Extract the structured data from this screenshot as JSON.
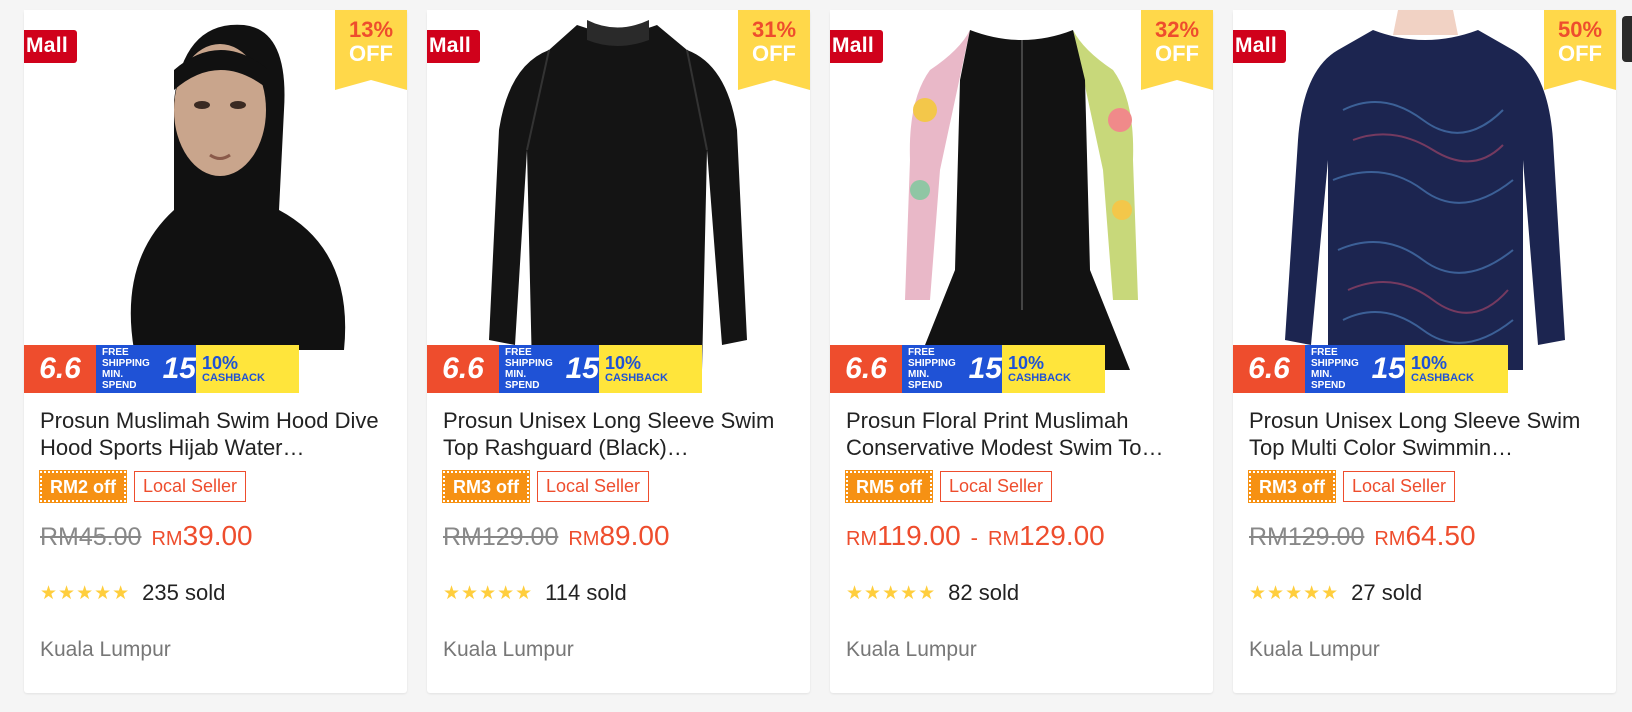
{
  "products": [
    {
      "mall": "Mall",
      "discount": "13%",
      "off_label": "OFF",
      "promo": {
        "sale": "6.6",
        "ship_text": "FREE SHIPPING MIN. SPEND",
        "ship_amount": "15",
        "cashback_pct": "10%",
        "cashback_label": "CASHBACK"
      },
      "name": "Prosun Muslimah Swim Hood Dive Hood Sports Hijab Water…",
      "voucher": "RM2 off",
      "seller": "Local Seller",
      "price_old": "RM45.00",
      "currency": "RM",
      "price": "39.00",
      "price_max": "",
      "stars": "★★★★★",
      "sold": "235 sold",
      "location": "Kuala Lumpur",
      "image": "black-hijab-swim-hood"
    },
    {
      "mall": "Mall",
      "discount": "31%",
      "off_label": "OFF",
      "promo": {
        "sale": "6.6",
        "ship_text": "FREE SHIPPING MIN. SPEND",
        "ship_amount": "15",
        "cashback_pct": "10%",
        "cashback_label": "CASHBACK"
      },
      "name": "Prosun Unisex Long Sleeve Swim Top Rashguard (Black)…",
      "voucher": "RM3 off",
      "seller": "Local Seller",
      "price_old": "RM129.00",
      "currency": "RM",
      "price": "89.00",
      "price_max": "",
      "stars": "★★★★★",
      "sold": "114 sold",
      "location": "Kuala Lumpur",
      "image": "black-rashguard"
    },
    {
      "mall": "Mall",
      "discount": "32%",
      "off_label": "OFF",
      "promo": {
        "sale": "6.6",
        "ship_text": "FREE SHIPPING MIN. SPEND",
        "ship_amount": "15",
        "cashback_pct": "10%",
        "cashback_label": "CASHBACK"
      },
      "name": "Prosun Floral Print Muslimah Conservative Modest Swim To…",
      "voucher": "RM5 off",
      "seller": "Local Seller",
      "price_old": "",
      "currency": "RM",
      "price": "119.00",
      "price_max": "129.00",
      "stars": "★★★★★",
      "sold": "82 sold",
      "location": "Kuala Lumpur",
      "image": "floral-swim-dress"
    },
    {
      "mall": "Mall",
      "discount": "50%",
      "off_label": "OFF",
      "promo": {
        "sale": "6.6",
        "ship_text": "FREE SHIPPING MIN. SPEND",
        "ship_amount": "15",
        "cashback_pct": "10%",
        "cashback_label": "CASHBACK"
      },
      "name": "Prosun Unisex Long Sleeve Swim Top Multi Color Swimmin…",
      "voucher": "RM3 off",
      "seller": "Local Seller",
      "price_old": "RM129.00",
      "currency": "RM",
      "price": "64.50",
      "price_max": "",
      "stars": "★★★★★",
      "sold": "27 sold",
      "location": "Kuala Lumpur",
      "image": "navy-pattern-swim-top"
    }
  ],
  "colors": {
    "accent": "#ee4d2d",
    "mall_red": "#d0011b",
    "badge_yellow": "#ffd84a",
    "voucher_orange": "#f69113",
    "star": "#ffce3d"
  }
}
